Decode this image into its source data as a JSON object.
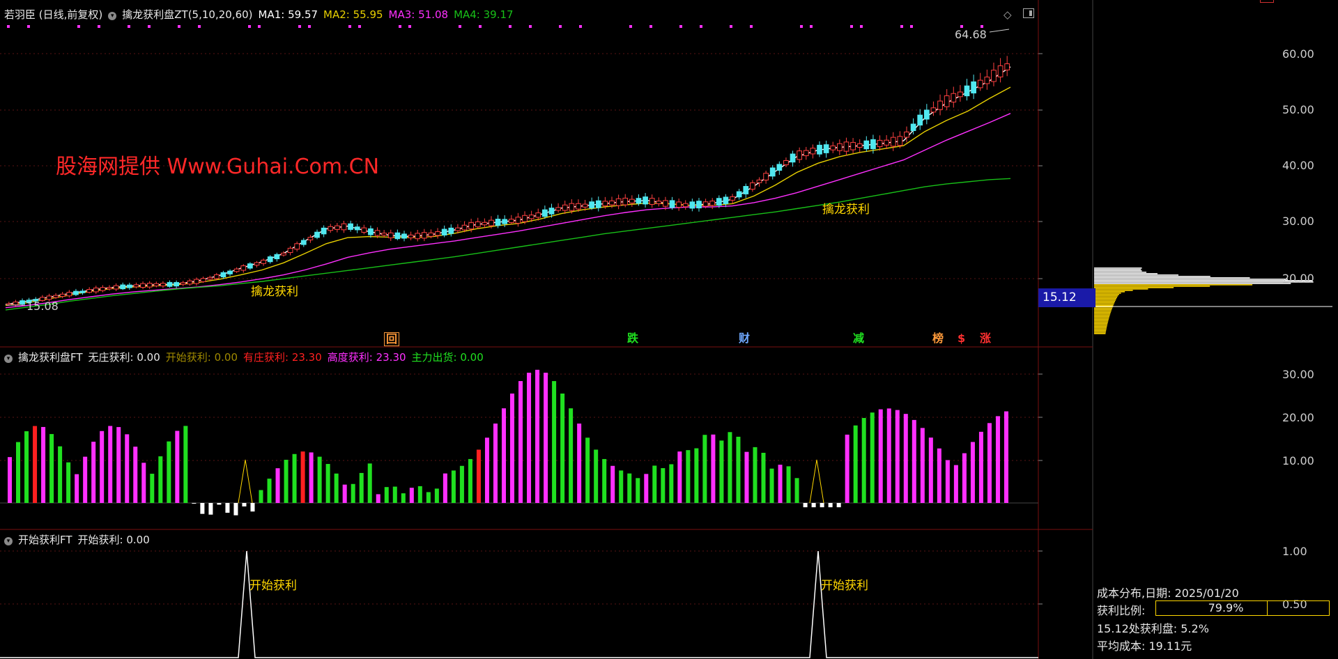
{
  "header": {
    "stock": "若羽臣 (日线,前复权)",
    "indicator": "擒龙获利盘ZT(5,10,20,60)",
    "ma1": "MA1: 59.57",
    "ma2": "MA2: 55.95",
    "ma3": "MA3: 51.08",
    "ma4": "MA4: 39.17"
  },
  "watermark": "股海网提供 Www.Guhai.Com.CN",
  "colors": {
    "ma1": "#ffffff",
    "ma2": "#e8d000",
    "ma3": "#ff30ff",
    "ma4": "#18c018",
    "up": "#ff4040",
    "down": "#50e8f0",
    "magenta": "#ff30ff",
    "green": "#20e020",
    "yellow": "#ffd700"
  },
  "main": {
    "high_label": "64.68",
    "low_label": "15.08",
    "signal1": "擒龙获利",
    "signal2": "擒龙获利",
    "y_labels": [
      "60.00",
      "50.00",
      "40.00",
      "30.00",
      "20.00"
    ],
    "price_tag": "15.12",
    "events": [
      {
        "text": "回",
        "color": "#ff9a3a"
      },
      {
        "text": "跌",
        "color": "#20e020"
      },
      {
        "text": "财",
        "color": "#6fa8ff"
      },
      {
        "text": "减",
        "color": "#20e020"
      },
      {
        "text": "榜",
        "color": "#ff9a3a"
      },
      {
        "text": "$",
        "color": "#ff3030"
      },
      {
        "text": "涨",
        "color": "#ff3030"
      }
    ]
  },
  "sub1": {
    "name": "擒龙获利盘FT",
    "v1": "无庄获利: 0.00",
    "v2": "开始获利: 0.00",
    "v3": "有庄获利: 23.30",
    "v4": "高度获利: 23.30",
    "v5": "主力出货: 0.00",
    "y_labels": [
      "30.00",
      "20.00",
      "10.00"
    ]
  },
  "sub2": {
    "name": "开始获利FT",
    "v1": "开始获利: 0.00",
    "y_labels": [
      "1.00",
      "0.50"
    ],
    "signal": "开始获利"
  },
  "cost": {
    "title": "成本分布,日期:  2025/01/20",
    "ratio_label": "获利比例:",
    "ratio_value": "79.9%",
    "ratio": 0.799,
    "line3": "15.12处获利盘:  5.2%",
    "line4": "平均成本:  19.11元"
  },
  "chart_data": {
    "type": "candlestick",
    "series": [
      {
        "name": "MA1",
        "values": [
          16.2,
          16.8,
          17.5,
          18.2,
          18.8,
          19.3,
          19.6,
          19.8,
          19.9,
          20.5,
          21.5,
          22.8,
          24.0,
          25.5,
          27.8,
          30.0,
          30.5,
          29.5,
          28.8,
          28.6,
          29.0,
          29.8,
          30.8,
          31.2,
          31.6,
          32.6,
          33.8,
          34.2,
          34.6,
          35.0,
          35.2,
          34.6,
          34.3,
          34.6,
          35.4,
          37.8,
          40.5,
          43.2,
          44.4,
          44.9,
          45.2,
          45.6,
          46.1,
          50.3,
          53.0,
          55.0,
          57.0,
          59.6
        ]
      },
      {
        "name": "MA2",
        "values": [
          16.0,
          16.5,
          17.2,
          17.9,
          18.6,
          19.1,
          19.4,
          19.6,
          19.8,
          20.2,
          20.8,
          21.6,
          22.5,
          23.8,
          25.5,
          27.3,
          28.4,
          28.6,
          28.5,
          28.4,
          28.6,
          29.2,
          30.0,
          30.6,
          31.0,
          31.8,
          32.8,
          33.5,
          34.0,
          34.4,
          34.7,
          34.6,
          34.3,
          34.3,
          34.6,
          36.0,
          38.0,
          40.3,
          42.0,
          43.2,
          44.0,
          44.6,
          45.2,
          47.8,
          49.8,
          51.5,
          53.8,
          55.9
        ]
      },
      {
        "name": "MA3",
        "values": [
          15.6,
          16.0,
          16.5,
          17.1,
          17.6,
          18.1,
          18.5,
          18.8,
          19.1,
          19.4,
          19.8,
          20.3,
          20.9,
          21.6,
          22.5,
          23.6,
          24.8,
          25.6,
          26.3,
          26.8,
          27.3,
          27.8,
          28.4,
          29.0,
          29.6,
          30.3,
          31.0,
          31.7,
          32.4,
          33.0,
          33.5,
          33.8,
          34.0,
          34.0,
          34.2,
          34.8,
          35.6,
          36.6,
          37.8,
          39.0,
          40.2,
          41.4,
          42.6,
          44.4,
          46.2,
          47.8,
          49.4,
          51.1
        ]
      },
      {
        "name": "MA4",
        "values": [
          15.2,
          15.7,
          16.2,
          16.8,
          17.3,
          17.8,
          18.2,
          18.6,
          19.0,
          19.3,
          19.6,
          20.0,
          20.4,
          20.9,
          21.4,
          21.9,
          22.4,
          22.9,
          23.4,
          23.9,
          24.4,
          24.9,
          25.5,
          26.1,
          26.7,
          27.3,
          27.9,
          28.5,
          29.1,
          29.6,
          30.1,
          30.6,
          31.1,
          31.6,
          32.1,
          32.6,
          33.1,
          33.7,
          34.3,
          34.9,
          35.6,
          36.3,
          37.0,
          37.7,
          38.2,
          38.6,
          39.0,
          39.2
        ]
      }
    ],
    "high": 64.68,
    "low": 15.08,
    "ylim": [
      12,
      68
    ],
    "subchart1": {
      "title": "擒龙获利盘FT",
      "ylim": [
        -5,
        32
      ],
      "y_ticks": [
        30,
        20,
        10
      ]
    },
    "subchart2": {
      "title": "开始获利FT",
      "ylim": [
        0,
        1
      ],
      "y_ticks": [
        1.0,
        0.5
      ]
    }
  }
}
